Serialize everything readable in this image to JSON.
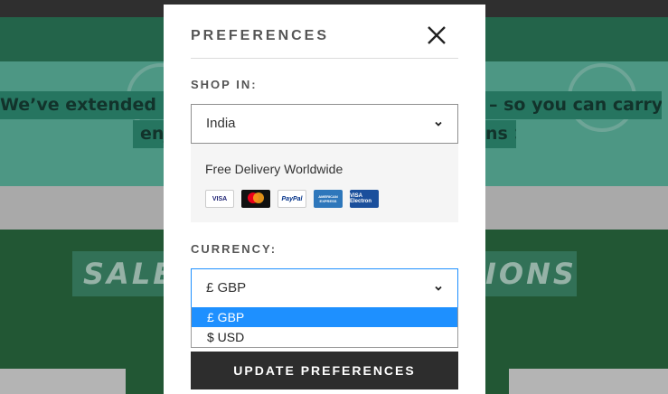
{
  "background": {
    "banner_line_left": "We’ve extended retu",
    "banner_line_right": "– so you can carry on",
    "banner_line2_left": "enj",
    "banner_line2_right": "ns >",
    "sale_left": "SALE",
    "sale_right": "IONS"
  },
  "modal": {
    "title": "PREFERENCES",
    "close_icon": "close-icon"
  },
  "shop_in": {
    "label": "SHOP IN:",
    "value": "India",
    "icon": "chevron-down-icon"
  },
  "delivery": {
    "text": "Free Delivery Worldwide",
    "payment_methods": [
      "VISA",
      "mastercard",
      "PayPal",
      "AMERICAN EXPRESS",
      "VISA Electron"
    ]
  },
  "currency": {
    "label": "CURRENCY:",
    "value": "£ GBP",
    "icon": "chevron-down-icon",
    "options": [
      "£ GBP",
      "$ USD"
    ],
    "selected_index": 0
  },
  "update_button": {
    "label": "UPDATE PREFERENCES"
  },
  "colors": {
    "accent": "#1e90ff",
    "button": "#2d2d2d"
  }
}
